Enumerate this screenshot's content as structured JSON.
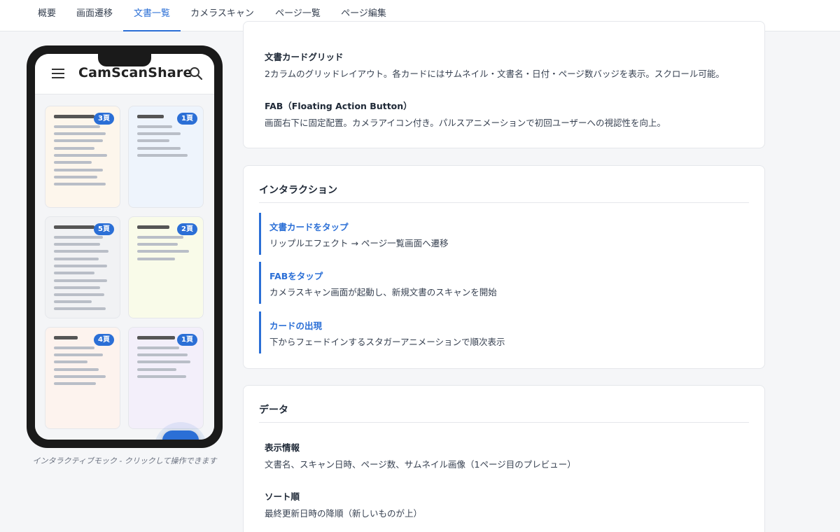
{
  "tabs": [
    {
      "label": "概要"
    },
    {
      "label": "画面遷移"
    },
    {
      "label": "文書一覧"
    },
    {
      "label": "カメラスキャン"
    },
    {
      "label": "ページ一覧"
    },
    {
      "label": "ページ編集"
    }
  ],
  "active_tab": "文書一覧",
  "phone": {
    "app_title": "CamScanShare",
    "caption": "インタラクティブモック - クリックして操作できます",
    "cards": [
      {
        "badge": "3頁",
        "bg": "#fdf6ec"
      },
      {
        "badge": "1頁",
        "bg": "#eef4fc"
      },
      {
        "badge": "5頁",
        "bg": "#f1f2f4"
      },
      {
        "badge": "2頁",
        "bg": "#f9fbe9"
      },
      {
        "badge": "4頁",
        "bg": "#fdf3ee"
      },
      {
        "badge": "1頁",
        "bg": "#f3effa"
      }
    ]
  },
  "layout_section": {
    "items": [
      {
        "title": "文書カードグリッド",
        "desc": "2カラムのグリッドレイアウト。各カードにはサムネイル・文書名・日付・ページ数バッジを表示。スクロール可能。"
      },
      {
        "title": "FAB（Floating Action Button）",
        "desc": "画面右下に固定配置。カメラアイコン付き。パルスアニメーションで初回ユーザーへの視認性を向上。"
      }
    ]
  },
  "interaction_section": {
    "title": "インタラクション",
    "items": [
      {
        "title": "文書カードをタップ",
        "desc": "リップルエフェクト → ページ一覧画面へ遷移"
      },
      {
        "title": "FABをタップ",
        "desc": "カメラスキャン画面が起動し、新規文書のスキャンを開始"
      },
      {
        "title": "カードの出現",
        "desc": "下からフェードインするスタガーアニメーションで順次表示"
      }
    ]
  },
  "data_section": {
    "title": "データ",
    "items": [
      {
        "title": "表示情報",
        "desc": "文書名、スキャン日時、ページ数、サムネイル画像（1ページ目のプレビュー）"
      },
      {
        "title": "ソート順",
        "desc": "最終更新日時の降順（新しいものが上）"
      }
    ]
  },
  "colors": {
    "accent": "#2b6fd6",
    "background": "#f5f6f8"
  }
}
